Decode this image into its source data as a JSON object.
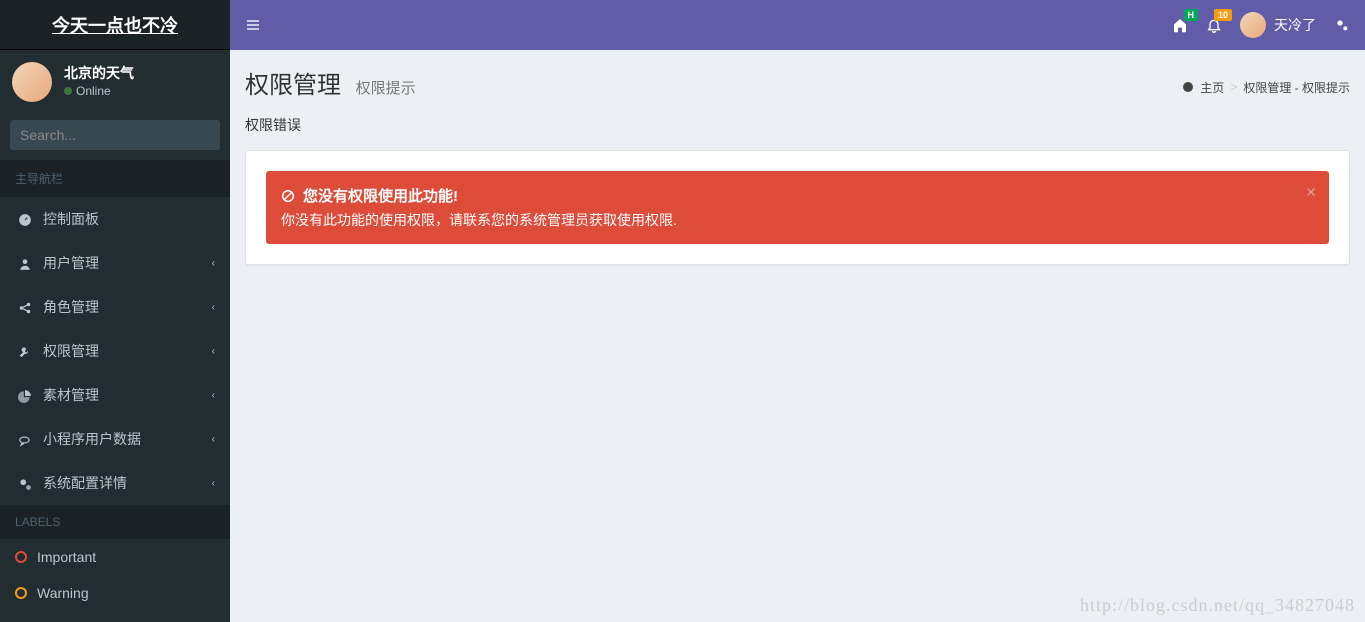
{
  "logo": "今天一点也不冷",
  "user": {
    "name": "北京的天气",
    "status": "Online"
  },
  "search": {
    "placeholder": "Search..."
  },
  "nav": {
    "header": "主导航栏",
    "items": [
      {
        "label": "控制面板"
      },
      {
        "label": "用户管理"
      },
      {
        "label": "角色管理"
      },
      {
        "label": "权限管理"
      },
      {
        "label": "素材管理"
      },
      {
        "label": "小程序用户数据"
      },
      {
        "label": "系统配置详情"
      }
    ],
    "labels_header": "LABELS",
    "labels": [
      {
        "label": "Important"
      },
      {
        "label": "Warning"
      }
    ]
  },
  "topbar": {
    "badge_home": "H",
    "badge_bell": "10",
    "username": "天冷了"
  },
  "page": {
    "title": "权限管理",
    "subtitle": "权限提示",
    "breadcrumb": {
      "home": "主页",
      "trail": "权限管理 - 权限提示"
    },
    "section_title": "权限错误",
    "alert": {
      "title": "您没有权限使用此功能!",
      "body": "你没有此功能的使用权限，请联系您的系统管理员获取使用权限."
    }
  },
  "watermark": "http://blog.csdn.net/qq_34827048"
}
